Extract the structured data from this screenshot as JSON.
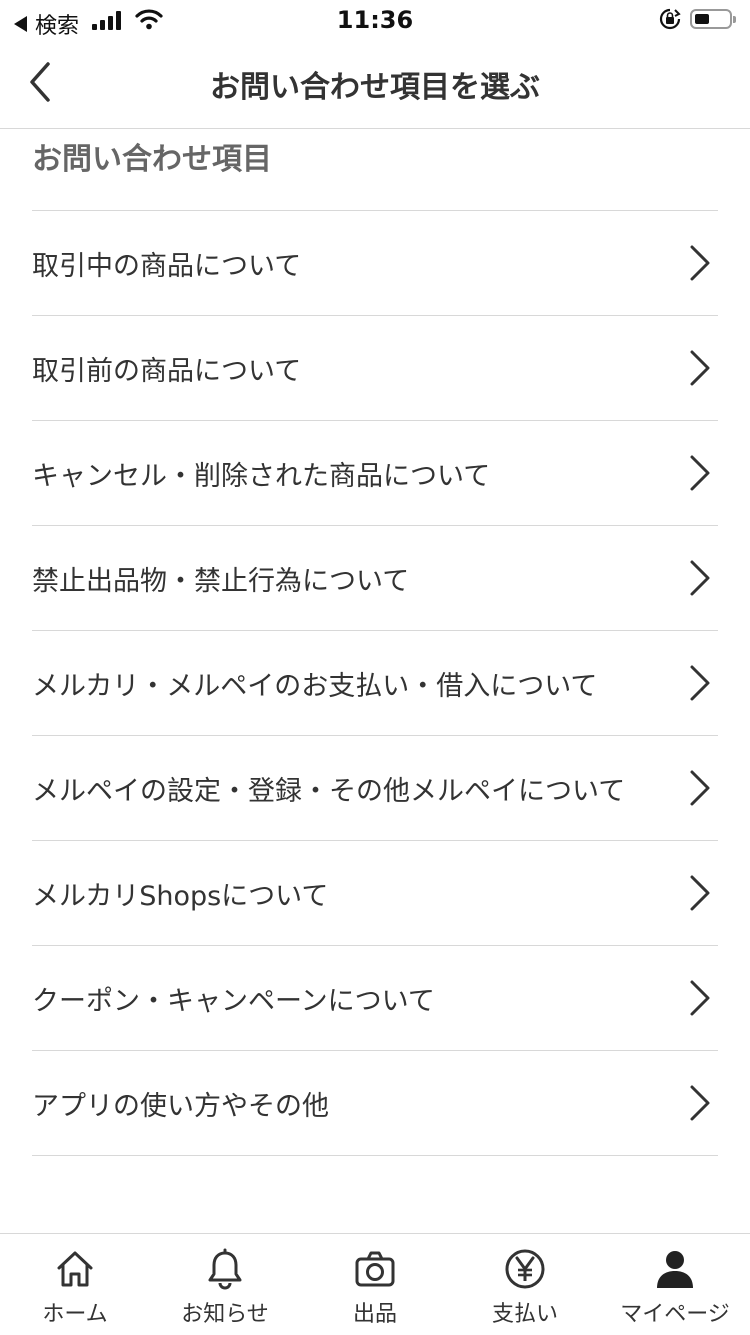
{
  "status_bar": {
    "back_app": "検索",
    "time": "11:36"
  },
  "header": {
    "title": "お問い合わせ項目を選ぶ"
  },
  "section": {
    "title": "お問い合わせ項目"
  },
  "items": [
    {
      "label": "取引中の商品について"
    },
    {
      "label": "取引前の商品について"
    },
    {
      "label": "キャンセル・削除された商品について"
    },
    {
      "label": "禁止出品物・禁止行為について"
    },
    {
      "label": "メルカリ・メルペイのお支払い・借入について"
    },
    {
      "label": "メルペイの設定・登録・その他メルペイについて"
    },
    {
      "label": "メルカリShopsについて"
    },
    {
      "label": "クーポン・キャンペーンについて"
    },
    {
      "label": "アプリの使い方やその他"
    }
  ],
  "tabbar": {
    "tabs": [
      {
        "label": "ホーム",
        "icon": "home-icon"
      },
      {
        "label": "お知らせ",
        "icon": "bell-icon"
      },
      {
        "label": "出品",
        "icon": "camera-icon"
      },
      {
        "label": "支払い",
        "icon": "yen-icon"
      },
      {
        "label": "マイページ",
        "icon": "person-icon"
      }
    ]
  }
}
